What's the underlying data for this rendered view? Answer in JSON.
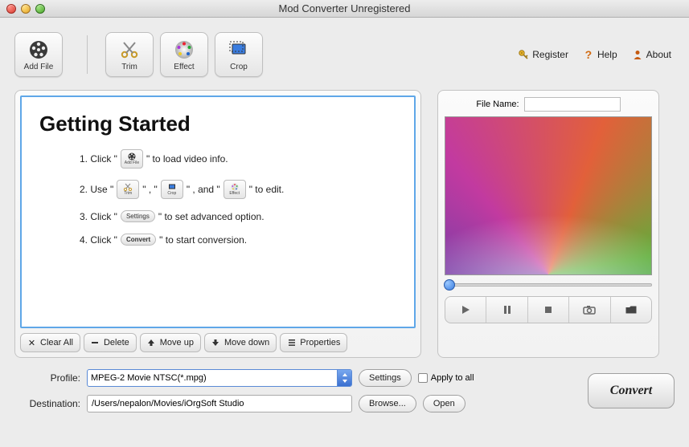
{
  "window": {
    "title": "Mod Converter Unregistered"
  },
  "toolbar": {
    "addFile": "Add File",
    "trim": "Trim",
    "effect": "Effect",
    "crop": "Crop"
  },
  "topLinks": {
    "register": "Register",
    "help": "Help",
    "about": "About"
  },
  "gettingStarted": {
    "heading": "Getting Started",
    "step1_a": "1. Click \"",
    "step1_b": "\" to load video info.",
    "step2_a": "2. Use \"",
    "step2_b": "\" , \"",
    "step2_c": "\" , and \"",
    "step2_d": "\" to edit.",
    "step3_a": "3. Click \"",
    "step3_b": "\" to set advanced option.",
    "step4_a": "4. Click \"",
    "step4_b": "\" to start conversion.",
    "miniAddFile": "Add File",
    "miniTrim": "Trim",
    "miniCrop": "Crop",
    "miniEffect": "Effect",
    "miniSettings": "Settings",
    "miniConvert": "Convert"
  },
  "listActions": {
    "clearAll": "Clear All",
    "delete": "Delete",
    "moveUp": "Move up",
    "moveDown": "Move down",
    "properties": "Properties"
  },
  "preview": {
    "fileNameLabel": "File Name:",
    "fileNameValue": ""
  },
  "profile": {
    "label": "Profile:",
    "value": "MPEG-2 Movie NTSC(*.mpg)",
    "settings": "Settings",
    "applyAll": "Apply to all"
  },
  "destination": {
    "label": "Destination:",
    "value": "/Users/nepalon/Movies/iOrgSoft Studio",
    "browse": "Browse...",
    "open": "Open"
  },
  "convert": {
    "label": "Convert"
  }
}
